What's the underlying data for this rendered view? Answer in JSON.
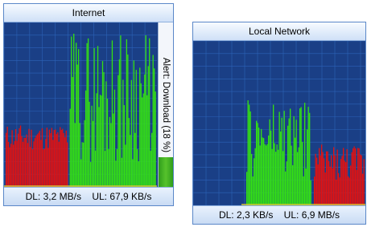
{
  "widgets": [
    {
      "title": "Internet",
      "footer": {
        "dl_label": "DL:",
        "dl_value": "3,2 MB/s",
        "ul_label": "UL:",
        "ul_value": "67,9 KB/s"
      },
      "alert": {
        "text": "Alert: Download (18 %)",
        "percent": 18
      }
    },
    {
      "title": "Local Network",
      "footer": {
        "dl_label": "DL:",
        "dl_value": "2,3 KB/s",
        "ul_label": "UL:",
        "ul_value": "6,9 MB/s"
      }
    }
  ],
  "colors": {
    "background": "#1a3f86",
    "grid": "#2c63b8",
    "download": "#e01212",
    "upload": "#34e014",
    "baseline": "#d7c63a"
  }
}
